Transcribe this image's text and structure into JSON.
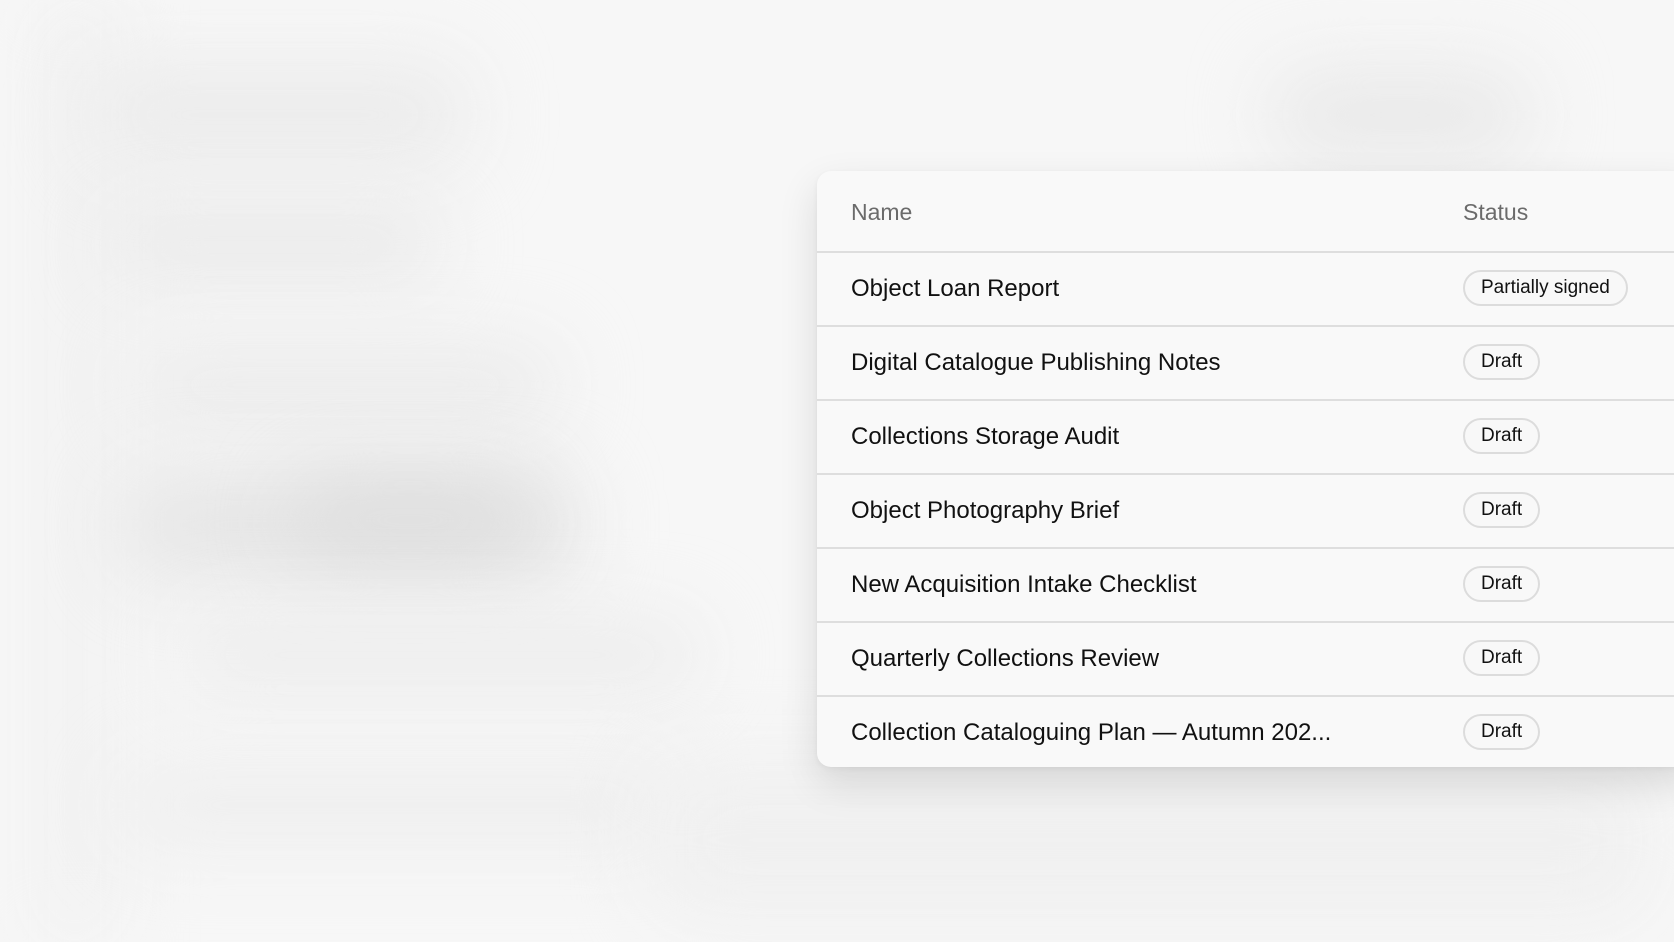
{
  "table": {
    "headers": {
      "name": "Name",
      "status": "Status"
    },
    "rows": [
      {
        "name": "Object Loan Report",
        "status": "Partially signed"
      },
      {
        "name": "Digital Catalogue Publishing Notes",
        "status": "Draft"
      },
      {
        "name": "Collections Storage Audit",
        "status": "Draft"
      },
      {
        "name": "Object Photography Brief",
        "status": "Draft"
      },
      {
        "name": "New Acquisition Intake Checklist",
        "status": "Draft"
      },
      {
        "name": "Quarterly Collections Review",
        "status": "Draft"
      },
      {
        "name": "Collection Cataloguing Plan — Autumn 202...",
        "status": "Draft"
      }
    ]
  }
}
